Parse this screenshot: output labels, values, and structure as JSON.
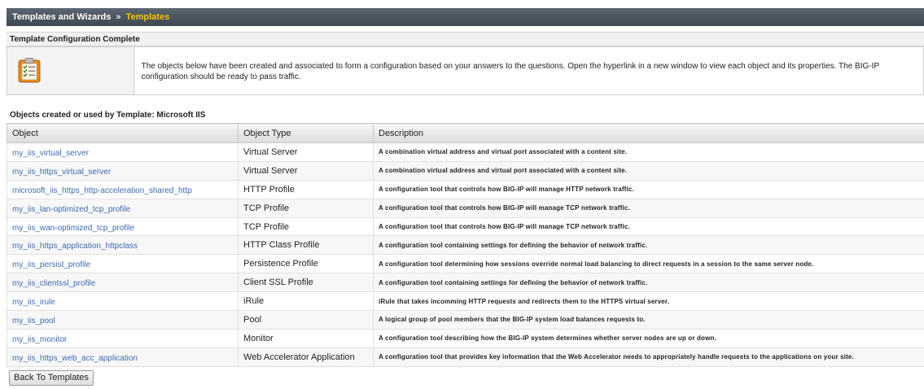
{
  "breadcrumb": {
    "parent": "Templates and Wizards",
    "separator": "»",
    "current": "Templates"
  },
  "section_title": "Template Configuration Complete",
  "info": {
    "icon": "clipboard-checklist-icon",
    "text": "The objects below have been created and associated to form a configuration based on your answers to the questions. Open the hyperlink in a new window to view each object and its properties. The BIG-IP configuration should be ready to pass traffic."
  },
  "objects_title": "Objects created or used by Template: Microsoft IIS",
  "table": {
    "headers": [
      "Object",
      "Object Type",
      "Description"
    ],
    "rows": [
      {
        "object": "my_iis_virtual_server",
        "type": "Virtual Server",
        "description": "A combination virtual address and virtual port associated with a content site."
      },
      {
        "object": "my_iis_https_virtual_server",
        "type": "Virtual Server",
        "description": "A combination virtual address and virtual port associated with a content site."
      },
      {
        "object": "microsoft_iis_https_http-acceleration_shared_http",
        "type": "HTTP Profile",
        "description": "A configuration tool that controls how BIG-IP will manage HTTP network traffic."
      },
      {
        "object": "my_iis_lan-optimized_tcp_profile",
        "type": "TCP Profile",
        "description": "A configuration tool that controls how BIG-IP will manage TCP network traffic."
      },
      {
        "object": "my_iis_wan-optimized_tcp_profile",
        "type": "TCP Profile",
        "description": "A configuration tool that controls how BIG-IP will manage TCP network traffic."
      },
      {
        "object": "my_iis_https_application_httpclass",
        "type": "HTTP Class Profile",
        "description": "A configuration tool containing settings for defining the behavior of network traffic."
      },
      {
        "object": "my_iis_persist_profile",
        "type": "Persistence Profile",
        "description": "A configuration tool determining how sessions override normal load balancing to direct requests in a session to the same server node."
      },
      {
        "object": "my_iis_clientssl_profile",
        "type": "Client SSL Profile",
        "description": "A configuration tool containing settings for defining the behavior of network traffic."
      },
      {
        "object": "my_iis_irule",
        "type": "iRule",
        "description": "iRule that takes incomming HTTP requests and redirects them to the HTTPS virtual server."
      },
      {
        "object": "my_iis_pool",
        "type": "Pool",
        "description": "A logical group of pool members that the BIG-IP system load balances requests to."
      },
      {
        "object": "my_iis_monitor",
        "type": "Monitor",
        "description": "A configuration tool describing how the BIG-IP system determines whether server nodes are up or down."
      },
      {
        "object": "my_iis_https_web_acc_application",
        "type": "Web Accelerator Application",
        "description": "A configuration tool that provides key information that the Web Accelerator needs to appropriately handle requests to the applications on your site."
      }
    ]
  },
  "back_button": "Back To Templates"
}
